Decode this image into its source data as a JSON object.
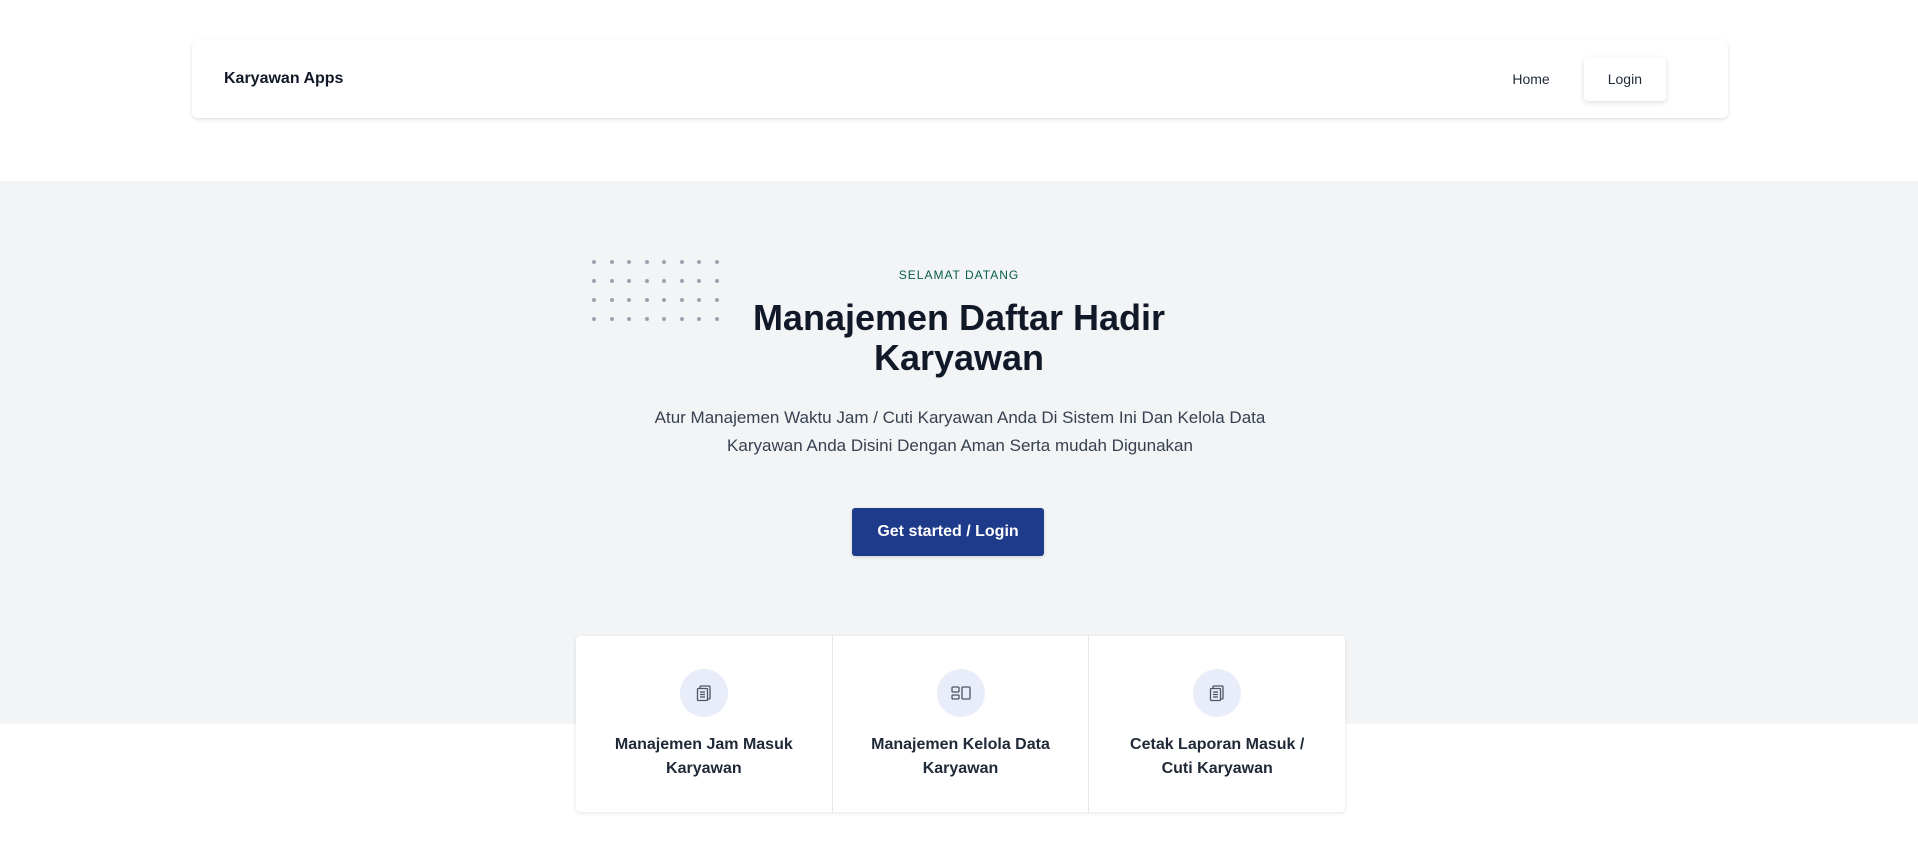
{
  "navbar": {
    "brand": "Karyawan Apps",
    "links": [
      {
        "label": "Home"
      },
      {
        "label": "Login"
      }
    ]
  },
  "hero": {
    "eyebrow": "SELAMAT DATANG",
    "title": "Manajemen Daftar Hadir Karyawan",
    "subtitle": "Atur Manajemen Waktu Jam / Cuti Karyawan Anda Di Sistem Ini Dan Kelola Data Karyawan Anda Disini Dengan Aman Serta mudah Digunakan",
    "cta_label": "Get started / Login",
    "accent_color": "#1e3a8a"
  },
  "features": [
    {
      "icon": "clipboard-icon",
      "label": "Manajemen Jam Masuk Karyawan"
    },
    {
      "icon": "layout-icon",
      "label": "Manajemen Kelola Data Karyawan"
    },
    {
      "icon": "clipboard-icon",
      "label": "Cetak Laporan Masuk / Cuti Karyawan"
    }
  ]
}
